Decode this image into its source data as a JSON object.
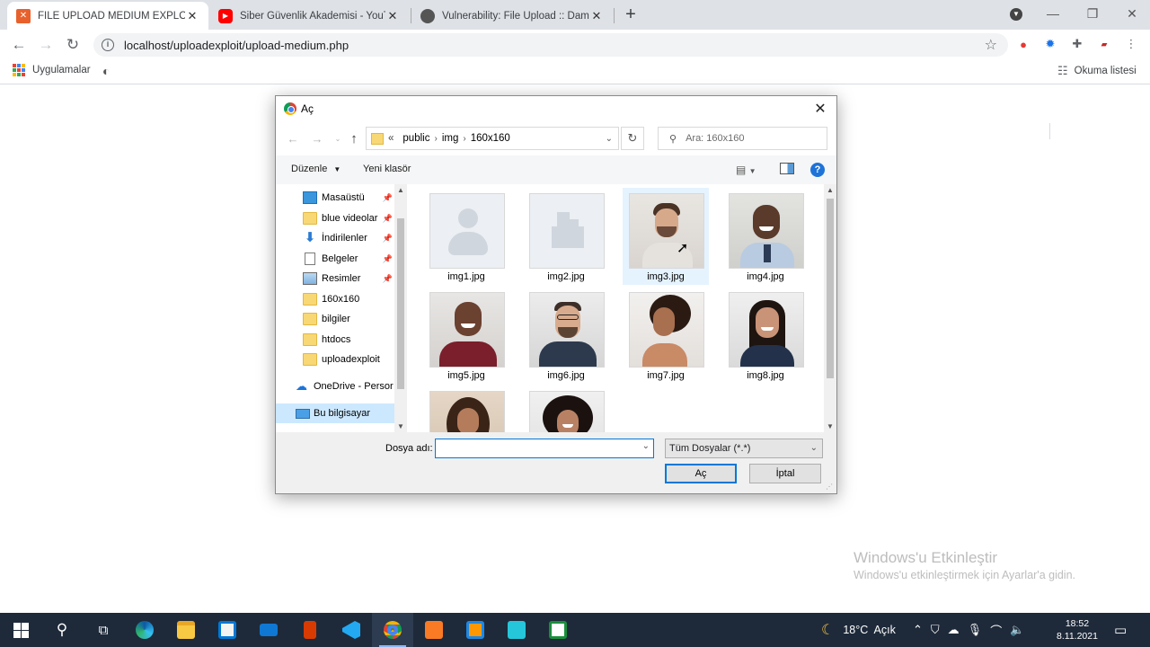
{
  "browser": {
    "tabs": [
      {
        "title": "FILE UPLOAD MEDIUM EXPLOIT",
        "active": true
      },
      {
        "title": "Siber Güvenlik Akademisi - YouTu",
        "active": false
      },
      {
        "title": "Vulnerability: File Upload :: Damn",
        "active": false
      }
    ],
    "new_tab": "+",
    "url": "localhost/uploadexploit/upload-medium.php",
    "bookmarks": {
      "apps": "Uygulamalar",
      "reading_list": "Okuma listesi"
    }
  },
  "dialog": {
    "title": "Aç",
    "breadcrumb": {
      "overflow": "«",
      "items": [
        "public",
        "img",
        "160x160"
      ]
    },
    "search_placeholder": "Ara: 160x160",
    "organize": "Düzenle",
    "new_folder": "Yeni klasör",
    "nav_items": [
      {
        "label": "Masaüstü",
        "pinned": true
      },
      {
        "label": "blue videolar",
        "pinned": true
      },
      {
        "label": "İndirilenler",
        "pinned": true
      },
      {
        "label": "Belgeler",
        "pinned": true
      },
      {
        "label": "Resimler",
        "pinned": true
      },
      {
        "label": "160x160",
        "pinned": false
      },
      {
        "label": "bilgiler",
        "pinned": false
      },
      {
        "label": "htdocs",
        "pinned": false
      },
      {
        "label": "uploadexploit",
        "pinned": false
      },
      {
        "label": "OneDrive - Persor",
        "pinned": false
      },
      {
        "label": "Bu bilgisayar",
        "pinned": false
      }
    ],
    "files": [
      {
        "name": "img1.jpg",
        "kind": "person-placeholder"
      },
      {
        "name": "img2.jpg",
        "kind": "building-placeholder"
      },
      {
        "name": "img3.jpg",
        "kind": "photo",
        "selected": true
      },
      {
        "name": "img4.jpg",
        "kind": "photo"
      },
      {
        "name": "img5.jpg",
        "kind": "photo"
      },
      {
        "name": "img6.jpg",
        "kind": "photo"
      },
      {
        "name": "img7.jpg",
        "kind": "photo"
      },
      {
        "name": "img8.jpg",
        "kind": "photo"
      },
      {
        "name": "",
        "kind": "photo"
      },
      {
        "name": "",
        "kind": "photo"
      }
    ],
    "filename_label": "Dosya adı:",
    "filename_value": "",
    "filter": "Tüm Dosyalar (*.*)",
    "open_button": "Aç",
    "cancel_button": "İptal"
  },
  "watermark": {
    "title": "Windows'u Etkinleştir",
    "subtitle": "Windows'u etkinleştirmek için Ayarlar'a gidin."
  },
  "taskbar": {
    "weather": "18°C  Açık",
    "time": "18:52",
    "date": "8.11.2021"
  },
  "colors": {
    "accent": "#0078d7",
    "taskbar": "#1e2a3a",
    "tab_strip": "#dee1e6"
  }
}
